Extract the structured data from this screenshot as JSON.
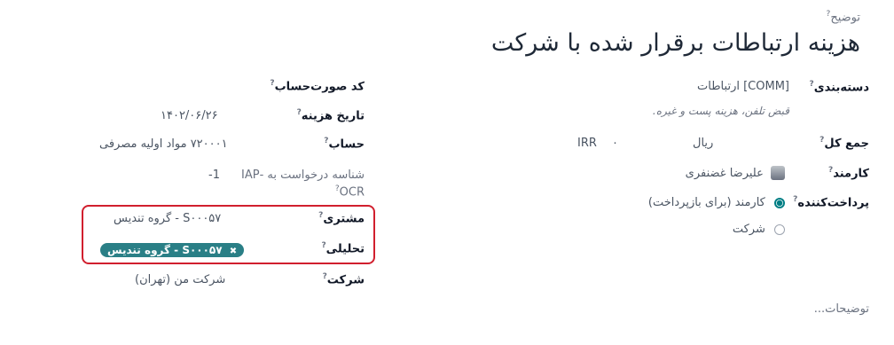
{
  "description_label": "توضیح",
  "title": "هزینه ارتباطات برقرار شده با شرکت",
  "right": {
    "category": {
      "label": "دسته‌بندی",
      "value": "[COMM] ارتباطات",
      "hint": "قبض تلفن، هزینه پست و غیره."
    },
    "total": {
      "label": "جمع کل",
      "amount": "۰",
      "currency_name": "ریال",
      "currency_code": "IRR"
    },
    "employee": {
      "label": "کارمند",
      "value": "علیرضا غضنفری"
    },
    "paid_by": {
      "label": "پرداخت‌کننده",
      "options": [
        "کارمند (برای بازپرداخت)",
        "شرکت"
      ],
      "selected": 0
    },
    "notes_placeholder": "توضیحات..."
  },
  "left": {
    "account_code": {
      "label": "کد صورت‌حساب"
    },
    "expense_date": {
      "label": "تاریخ هزینه",
      "value": "۱۴۰۲/۰۶/۲۶"
    },
    "account": {
      "label": "حساب",
      "value": "۷۲۰۰۰۱ مواد اولیه مصرفی"
    },
    "iap": {
      "label_line1": "شناسه درخواست به -IAP",
      "label_line2": "OCR",
      "value": "-1"
    },
    "customer": {
      "label": "مشتری",
      "value": "S۰۰۰۵۷ - گروه تندیس"
    },
    "analytic": {
      "label": "تحلیلی",
      "tag": "S۰۰۰۵۷ - گروه تندیس",
      "tag_remove": "✖"
    },
    "company": {
      "label": "شرکت",
      "value": "شرکت من (تهران)"
    }
  },
  "colors": {
    "accent": "#017e84",
    "tag": "#2a7f86",
    "highlight_border": "#d11f2e"
  }
}
